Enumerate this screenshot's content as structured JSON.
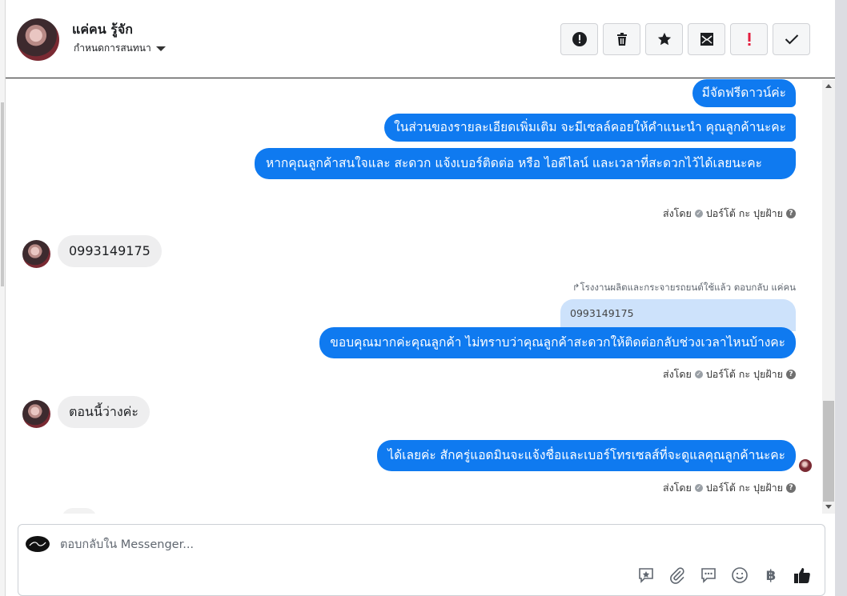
{
  "header": {
    "contact_name": "แค่คน รู้จัก",
    "assign_label": "กำหนดการสนทนา",
    "actions": [
      {
        "name": "report-spam-button",
        "icon": "exclamation-circle-icon"
      },
      {
        "name": "delete-button",
        "icon": "trash-icon"
      },
      {
        "name": "star-button",
        "icon": "star-icon"
      },
      {
        "name": "mark-unread-button",
        "icon": "envelope-icon"
      },
      {
        "name": "mark-important-button",
        "icon": "exclamation-icon"
      },
      {
        "name": "mark-done-button",
        "icon": "check-icon"
      }
    ]
  },
  "messages": {
    "out1": "มีจัดฟรีดาวน์ค่ะ",
    "out2": "ในส่วนของรายละเอียดเพิ่มเติม จะมีเซลล์คอยให้คำแนะนำ คุณลูกค้านะคะ",
    "out3": "หากคุณลูกค้าสนใจและ สะดวก แจ้งเบอร์ติดต่อ หรือ ไอดีไลน์ และเวลาที่สะดวกไว้ได้เลยนะคะ",
    "sent_by_label": "ส่งโดย",
    "sender_name": "ปอร์โต้ กะ ปุยฝ้าย",
    "in1": "0993149175",
    "reply_meta": "โรงงานผลิตและกระจายรถยนต์ใช้แล้ว ตอบกลับ แค่คน",
    "quoted": "0993149175",
    "out4": "ขอบคุณมากค่ะคุณลูกค้า ไม่ทราบว่าคุณลูกค้าสะดวกให้ติดต่อกลับช่วงเวลาไหนบ้างคะ",
    "in2": "ตอนนี้ว่างค่ะ",
    "out5": "ได้เลยค่ะ สักครู่แอดมินจะแจ้งชื่อและเบอร์โทรเซลส์ที่จะดูแลคุณลูกค้านะคะ"
  },
  "composer": {
    "placeholder": "ตอบกลับใน Messenger...",
    "tools": [
      "saved-reply-icon",
      "attachment-icon",
      "comment-icon",
      "emoji-icon",
      "baht-icon",
      "thumbs-up-icon"
    ],
    "baht_symbol": "฿"
  },
  "colors": {
    "outgoing_bubble": "#0f7af0",
    "incoming_bubble": "#eeeeef",
    "quoted_bubble": "#cde2fb"
  }
}
